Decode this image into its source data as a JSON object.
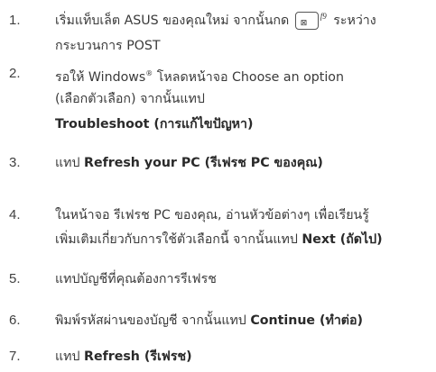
{
  "steps": [
    {
      "number": "1.",
      "line1_before": "เริ่มแท็บเล็ต ASUS ของคุณใหม่ จากนั้นกด",
      "key": {
        "fkey": "f9",
        "icon": "drive-icon"
      },
      "line1_after": "ระหว่าง",
      "line2": "กระบวนการ POST"
    },
    {
      "number": "2.",
      "line1_before": "รอให้ Windows",
      "trademark": "®",
      "line1_after": " โหลดหน้าจอ Choose an option",
      "line2": "(เลือกตัวเลือก) จากนั้นแทป",
      "line3": "Troubleshoot (การแก้ไขปัญหา)"
    },
    {
      "number": "3.",
      "text": "แทป ",
      "bold": "Refresh your PC (รีเฟรช PC ของคุณ)"
    },
    {
      "number": "4.",
      "line1": "ในหน้าจอ รีเฟรช PC ของคุณ, อ่านหัวข้อต่างๆ เพื่อเรียนรู้",
      "line2_text": "เพิ่มเติมเกี่ยวกับการใช้ตัวเลือกนี้ จากนั้นแทป ",
      "line2_bold": "Next (ถัดไป)"
    },
    {
      "number": "5.",
      "text": "แทปบัญชีที่คุณต้องการรีเฟรช"
    },
    {
      "number": "6.",
      "text": "พิมพ์รหัสผ่านของบัญชี จากนั้นแทป ",
      "bold": "Continue (ทำต่อ)"
    },
    {
      "number": "7.",
      "text": "แทป ",
      "bold": "Refresh (รีเฟรช)"
    }
  ]
}
